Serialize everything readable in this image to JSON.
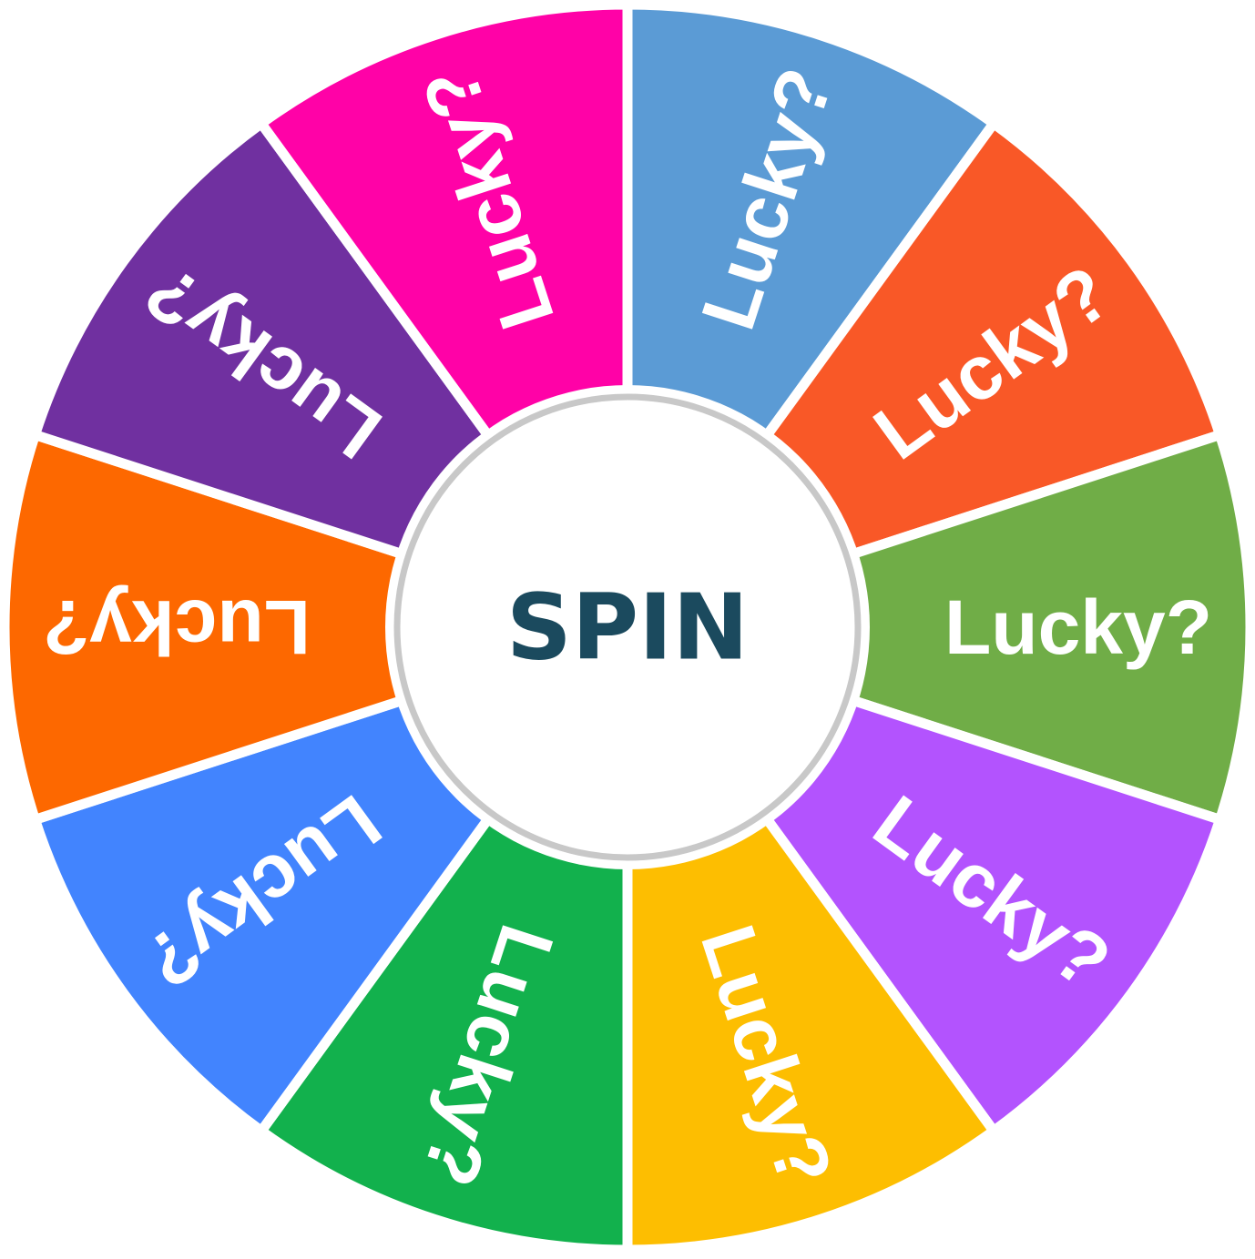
{
  "wheel": {
    "spin_label": "SPIN",
    "segments": [
      {
        "label": "Lucky?",
        "color": "#5b9bd5"
      },
      {
        "label": "Lucky?",
        "color": "#f95827"
      },
      {
        "label": "Lucky?",
        "color": "#70ad47"
      },
      {
        "label": "Lucky?",
        "color": "#b353fe"
      },
      {
        "label": "Lucky?",
        "color": "#fdbe01"
      },
      {
        "label": "Lucky?",
        "color": "#12b14d"
      },
      {
        "label": "Lucky?",
        "color": "#4284fe"
      },
      {
        "label": "Lucky?",
        "color": "#fd6800"
      },
      {
        "label": "Lucky?",
        "color": "#7030a0"
      },
      {
        "label": "Lucky?",
        "color": "#ff02a7"
      }
    ],
    "hub_fill": "#ffffff",
    "hub_border": "#c8c8c8",
    "spin_color": "#1b4a5e"
  }
}
